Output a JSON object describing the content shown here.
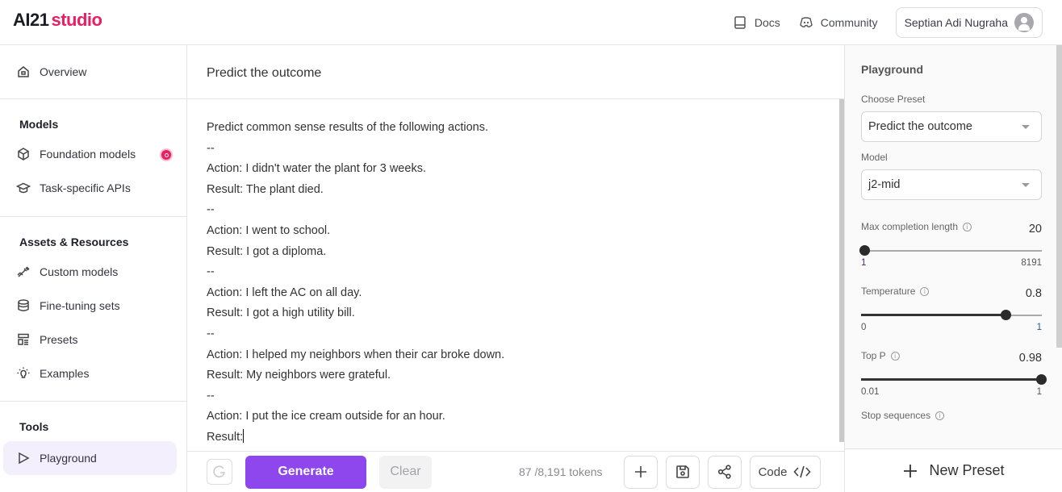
{
  "header": {
    "logo_ai": "AI21",
    "logo_studio": "studio",
    "links": [
      {
        "label": "Docs",
        "icon": "book-icon"
      },
      {
        "label": "Community",
        "icon": "discord-icon"
      }
    ],
    "user_name": "Septian Adi Nugraha"
  },
  "sidebar": {
    "overview": "Overview",
    "sections": [
      {
        "title": "Models",
        "items": [
          {
            "label": "Foundation models",
            "icon": "cube-icon",
            "badge": true
          },
          {
            "label": "Task-specific APIs",
            "icon": "graduation-cap-icon"
          }
        ]
      },
      {
        "title": "Assets & Resources",
        "items": [
          {
            "label": "Custom models",
            "icon": "dumbbell-icon"
          },
          {
            "label": "Fine-tuning sets",
            "icon": "database-icon"
          },
          {
            "label": "Presets",
            "icon": "template-icon"
          },
          {
            "label": "Examples",
            "icon": "lightbulb-icon"
          }
        ]
      },
      {
        "title": "Tools",
        "items": [
          {
            "label": "Playground",
            "icon": "play-icon",
            "active": true
          }
        ]
      }
    ]
  },
  "main": {
    "preset_title": "Predict the outcome",
    "prompt_lines": [
      "Predict common sense results of the following actions.",
      "--",
      "Action: I didn't water the plant for 3 weeks.",
      "Result: The plant died.",
      "--",
      "Action: I went to school.",
      "Result: I got a diploma.",
      "--",
      "Action: I left the AC on all day.",
      "Result: I got a high utility bill.",
      "--",
      "Action: I helped my neighbors when their car broke down.",
      "Result: My neighbors were grateful.",
      "--",
      "Action: I put the ice cream outside for an hour.",
      "Result:"
    ],
    "generate_label": "Generate",
    "clear_label": "Clear",
    "tokens": "87 /8,191 tokens",
    "code_label": "Code"
  },
  "panel": {
    "title": "Playground",
    "preset_label": "Choose Preset",
    "preset_value": "Predict the outcome",
    "model_label": "Model",
    "model_value": "j2-mid",
    "sliders": [
      {
        "label": "Max completion length",
        "value": "20",
        "min": "1",
        "max": "8191",
        "fraction": 0.002
      },
      {
        "label": "Temperature",
        "value": "0.8",
        "min": "0",
        "max": "1",
        "fraction": 0.8
      },
      {
        "label": "Top P",
        "value": "0.98",
        "min": "0.01",
        "max": "1",
        "fraction": 1.0
      }
    ],
    "stop_label": "Stop sequences",
    "new_preset_label": "New Preset"
  }
}
